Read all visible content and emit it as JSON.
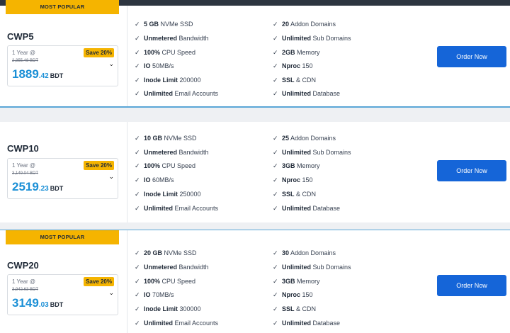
{
  "plans": [
    {
      "badge": "MOST POPULAR",
      "name": "CWP5",
      "cycle": "1 Year @",
      "save": "Save 20%",
      "old_price": "2,355.48 BDT",
      "price_int": "1889",
      "price_dec": ".42",
      "currency": "BDT",
      "order": "Order Now",
      "features_left": [
        {
          "bold": "5 GB",
          "rest": " NVMe SSD"
        },
        {
          "bold": "Unmetered",
          "rest": " Bandwidth"
        },
        {
          "bold": "100%",
          "rest": " CPU Speed"
        },
        {
          "bold": "IO",
          "rest": " 50MB/s"
        },
        {
          "bold": "Inode Limit",
          "rest": " 200000"
        },
        {
          "bold": "Unlimited",
          "rest": " Email Accounts"
        }
      ],
      "features_right": [
        {
          "bold": "20",
          "rest": " Addon Domains"
        },
        {
          "bold": "Unlimited",
          "rest": " Sub Domains"
        },
        {
          "bold": "2GB",
          "rest": " Memory"
        },
        {
          "bold": "Nproc",
          "rest": " 150"
        },
        {
          "bold": "SSL",
          "rest": " & CDN"
        },
        {
          "bold": "Unlimited",
          "rest": " Database"
        }
      ]
    },
    {
      "badge": "",
      "name": "CWP10",
      "cycle": "1 Year @",
      "save": "Save 20%",
      "old_price": "3,149.04 BDT",
      "price_int": "2519",
      "price_dec": ".23",
      "currency": "BDT",
      "order": "Order Now",
      "features_left": [
        {
          "bold": "10 GB",
          "rest": " NVMe SSD"
        },
        {
          "bold": "Unmetered",
          "rest": " Bandwidth"
        },
        {
          "bold": "100%",
          "rest": " CPU Speed"
        },
        {
          "bold": "IO",
          "rest": " 60MB/s"
        },
        {
          "bold": "Inode Limit",
          "rest": " 250000"
        },
        {
          "bold": "Unlimited",
          "rest": " Email Accounts"
        }
      ],
      "features_right": [
        {
          "bold": "25",
          "rest": " Addon Domains"
        },
        {
          "bold": "Unlimited",
          "rest": " Sub Domains"
        },
        {
          "bold": "3GB",
          "rest": " Memory"
        },
        {
          "bold": "Nproc",
          "rest": " 150"
        },
        {
          "bold": "SSL",
          "rest": " & CDN"
        },
        {
          "bold": "Unlimited",
          "rest": " Database"
        }
      ]
    },
    {
      "badge": "MOST POPULAR",
      "name": "CWP20",
      "cycle": "1 Year @",
      "save": "Save 20%",
      "old_price": "3,942.63 BDT",
      "price_int": "3149",
      "price_dec": ".03",
      "currency": "BDT",
      "order": "Order Now",
      "features_left": [
        {
          "bold": "20 GB",
          "rest": " NVMe SSD"
        },
        {
          "bold": "Unmetered",
          "rest": " Bandwidth"
        },
        {
          "bold": "100%",
          "rest": " CPU Speed"
        },
        {
          "bold": "IO",
          "rest": " 70MB/s"
        },
        {
          "bold": "Inode Limit",
          "rest": " 300000"
        },
        {
          "bold": "Unlimited",
          "rest": " Email Accounts"
        }
      ],
      "features_right": [
        {
          "bold": "30",
          "rest": " Addon Domains"
        },
        {
          "bold": "Unlimited",
          "rest": " Sub Domains"
        },
        {
          "bold": "3GB",
          "rest": " Memory"
        },
        {
          "bold": "Nproc",
          "rest": " 150"
        },
        {
          "bold": "SSL",
          "rest": " & CDN"
        },
        {
          "bold": "Unlimited",
          "rest": " Database"
        }
      ]
    }
  ],
  "icons": {
    "check": "check-icon",
    "chevron": "chevron-down-icon"
  },
  "colors": {
    "badge": "#f5b400",
    "price": "#1a8fd6",
    "button": "#1565d8",
    "accent_line": "#5aa6d6"
  }
}
